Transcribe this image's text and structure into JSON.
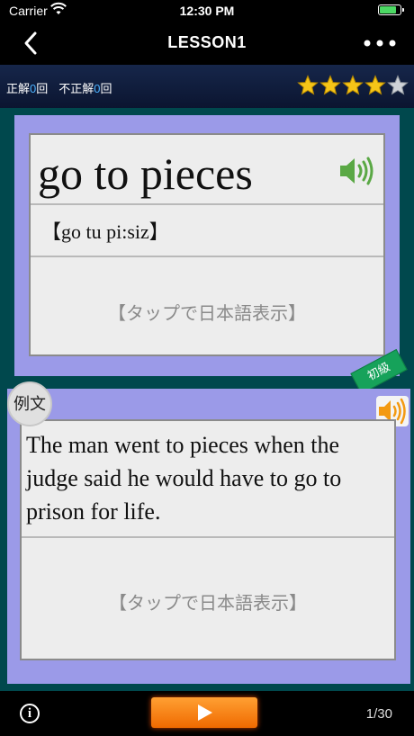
{
  "status_bar": {
    "carrier": "Carrier",
    "time": "12:30 PM",
    "battery_level": 0.85
  },
  "nav": {
    "title": "LESSON1"
  },
  "score": {
    "correct_label": "正解",
    "correct_count": "0",
    "incorrect_label": "不正解",
    "incorrect_count": "0",
    "count_suffix": "回",
    "stars_filled": 4,
    "stars_total": 5
  },
  "word_card": {
    "word": "go to pieces",
    "pronunciation": "【go tu pi:siz】",
    "tap_hint": "【タップで日本語表示】",
    "level": "初級"
  },
  "example_card": {
    "badge": "例文",
    "sentence": "The man went to pieces when the judge said he would have to go to prison for life.",
    "tap_hint": "【タップで日本語表示】"
  },
  "bottom": {
    "page": "1/30"
  },
  "colors": {
    "card_frame": "#9b9ae8",
    "card_face": "#ededed",
    "content_bg": "#00484d",
    "play_button": "#f58a1a",
    "count_blue": "#4db3ff"
  },
  "icons": {
    "back": "chevron-left-icon",
    "more": "ellipsis-icon",
    "speaker": "speaker-icon",
    "info": "info-icon",
    "play": "play-icon",
    "star": "star-icon"
  }
}
